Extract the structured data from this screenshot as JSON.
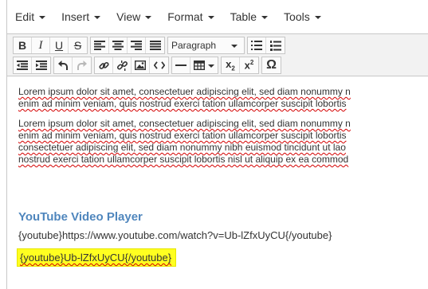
{
  "menubar": {
    "items": [
      {
        "label": "Edit"
      },
      {
        "label": "Insert"
      },
      {
        "label": "View"
      },
      {
        "label": "Format"
      },
      {
        "label": "Table"
      },
      {
        "label": "Tools"
      }
    ]
  },
  "toolbar": {
    "bold": "B",
    "italic": "I",
    "underline": "U",
    "strikethrough": "S",
    "format_select": "Paragraph",
    "subscript": "x",
    "subscript_mark": "2",
    "superscript": "x",
    "superscript_mark": "2",
    "special_char": "Ω",
    "icons": {
      "bold": "bold-icon",
      "italic": "italic-icon",
      "underline": "underline-icon",
      "strikethrough": "strikethrough-icon",
      "align_left": "align-left-icon",
      "align_center": "align-center-icon",
      "align_right": "align-right-icon",
      "align_justify": "align-justify-icon",
      "bullet_list": "bullet-list-icon",
      "numbered_list": "numbered-list-icon",
      "outdent": "outdent-icon",
      "indent": "indent-icon",
      "undo": "undo-icon",
      "redo": "redo-icon",
      "link": "link-icon",
      "unlink": "unlink-icon",
      "image": "image-icon",
      "code": "code-icon",
      "horizontal_rule": "horizontal-rule-icon",
      "table": "table-icon",
      "special_char": "omega-icon"
    }
  },
  "content": {
    "paragraph1": [
      "Lorem ipsum dolor sit amet, consectetuer adipiscing elit, sed diam nonummy n",
      "enim ad minim veniam, quis nostrud exerci tation ullamcorper suscipit lobortis"
    ],
    "paragraph2": [
      "Lorem ipsum dolor sit amet, consectetuer adipiscing elit, sed diam nonummy n",
      "enim ad minim veniam, quis nostrud exerci tation ullamcorper suscipit lobortis",
      "consectetuer adipiscing elit, sed diam nonummy nibh euismod tincidunt ut lao",
      "nostrud exerci tation ullamcorper suscipit lobortis nisl ut aliquip ex ea commod"
    ],
    "video_heading": "YouTube Video Player",
    "video_url": "{youtube}https://www.youtube.com/watch?v=Ub-lZfxUyCU{/youtube}",
    "highlighted_code": "{youtube}Ub-lZfxUyCU{/youtube}"
  },
  "colors": {
    "heading": "#4f86bd",
    "highlight": "#ffff20",
    "spellcheck": "#d40000"
  }
}
